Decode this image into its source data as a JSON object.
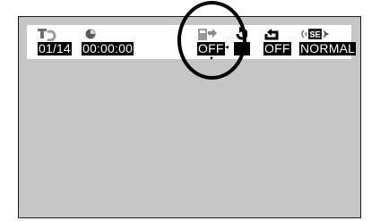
{
  "osd": {
    "title_chapter": {
      "icon": "title-chapter-icon",
      "value": "01/14"
    },
    "time": {
      "icon": "clock-icon",
      "value": "00:00:00"
    },
    "repeat_ab": {
      "icon": "repeat-ab-icon",
      "value": "OFF"
    },
    "repeat": {
      "icon": "repeat-icon",
      "value": ""
    },
    "repeat_all": {
      "icon": "repeat-all-icon",
      "value": "OFF"
    },
    "sound_effect": {
      "icon": "sound-effect-icon",
      "icon_label": "SE",
      "value": "NORMAL"
    }
  },
  "colors": {
    "screen_background": "#c6c6c6",
    "osd_background": "#ffffff",
    "value_background": "#000000",
    "value_text": "#ffffff"
  }
}
